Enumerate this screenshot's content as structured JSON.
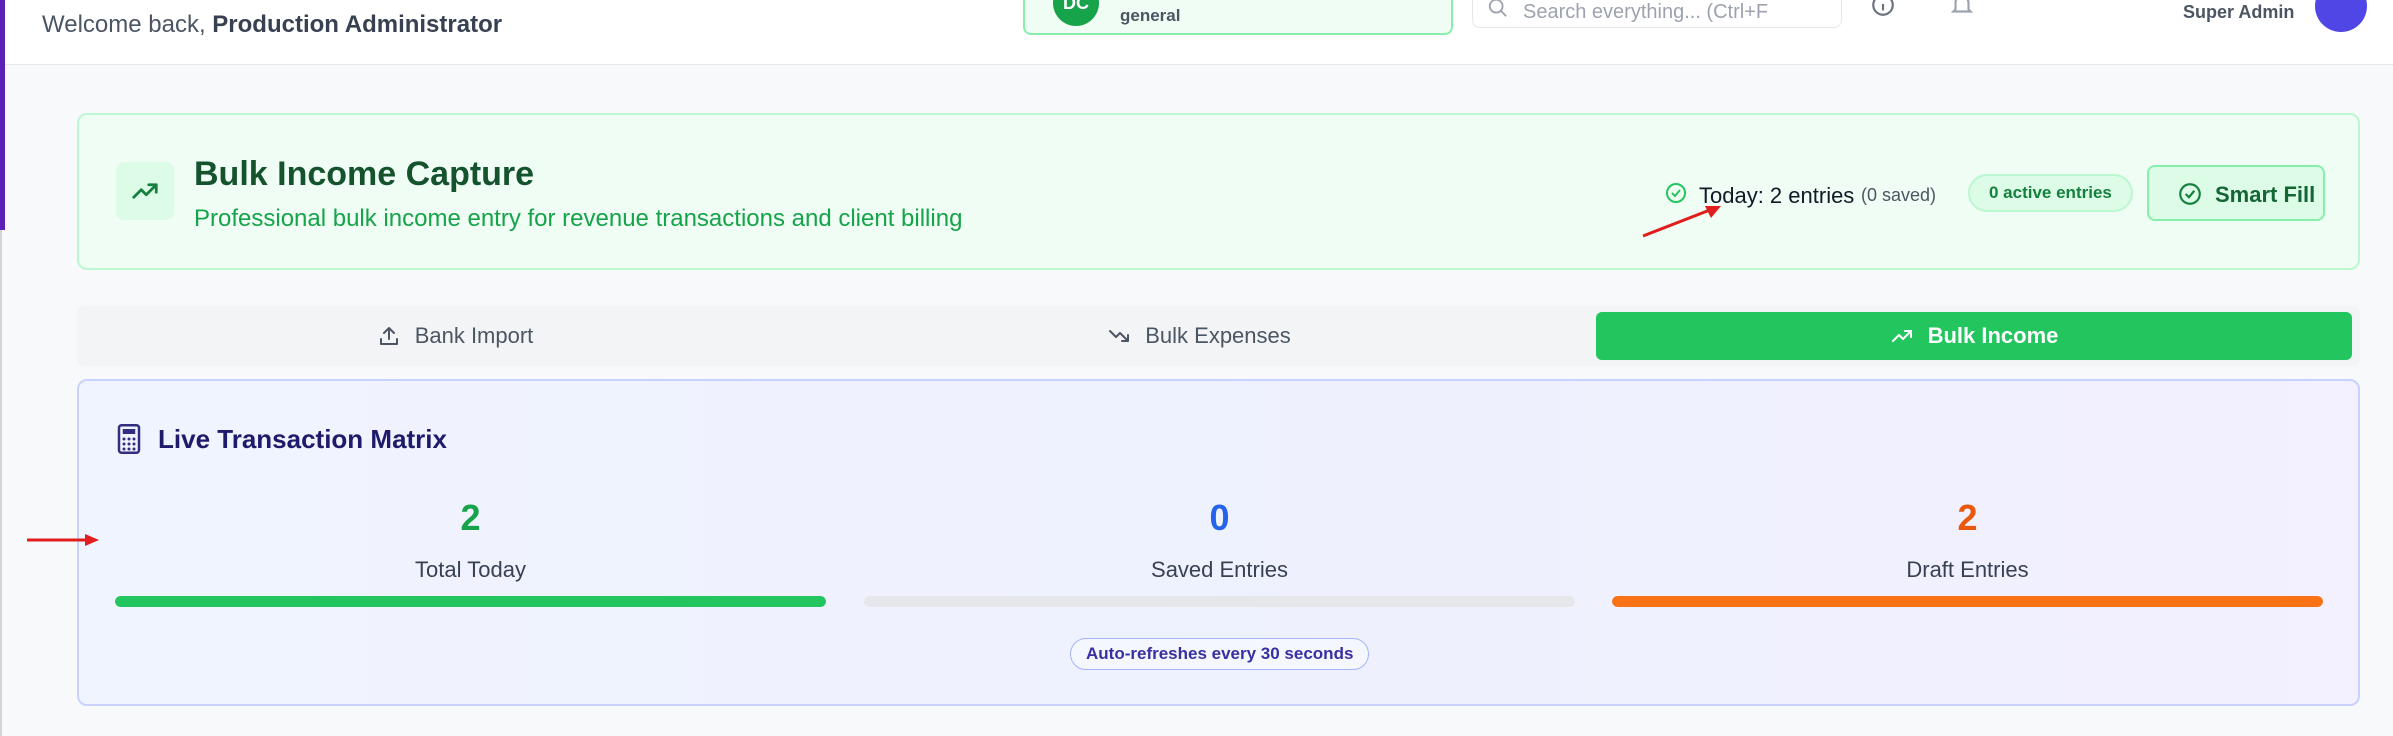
{
  "header": {
    "welcome_prefix": "Welcome back, ",
    "welcome_user": "Production Administrator",
    "org_initials": "DC",
    "org_subtitle": "general",
    "search_placeholder": "Search everything... (Ctrl+F",
    "user_role": "Super Admin"
  },
  "hero": {
    "title": "Bulk Income Capture",
    "subtitle": "Professional bulk income entry for revenue transactions and client billing",
    "today_label": "Today: 2 entries",
    "today_saved": "(0 saved)",
    "active_entries": "0 active entries",
    "smart_fill_label": "Smart Fill"
  },
  "tabs": [
    {
      "label": "Bank Import",
      "icon": "upload-icon",
      "active": false
    },
    {
      "label": "Bulk Expenses",
      "icon": "trending-down-icon",
      "active": false
    },
    {
      "label": "Bulk Income",
      "icon": "trending-up-icon",
      "active": true
    }
  ],
  "matrix": {
    "title": "Live Transaction Matrix",
    "stats": [
      {
        "value": "2",
        "label": "Total Today",
        "color": "#16a34a",
        "bar_color": "#22c55e",
        "fill": 1.0
      },
      {
        "value": "0",
        "label": "Saved Entries",
        "color": "#2563eb",
        "bar_color": "#3b82f6",
        "fill": 0.0
      },
      {
        "value": "2",
        "label": "Draft Entries",
        "color": "#ea580c",
        "bar_color": "#f97316",
        "fill": 1.0
      }
    ],
    "refresh_note": "Auto-refreshes every 30 seconds"
  },
  "colors": {
    "brand_green": "#22c55e",
    "dark_green": "#14532d",
    "indigo": "#4f46e5",
    "annotation_red": "#e11d1d"
  }
}
